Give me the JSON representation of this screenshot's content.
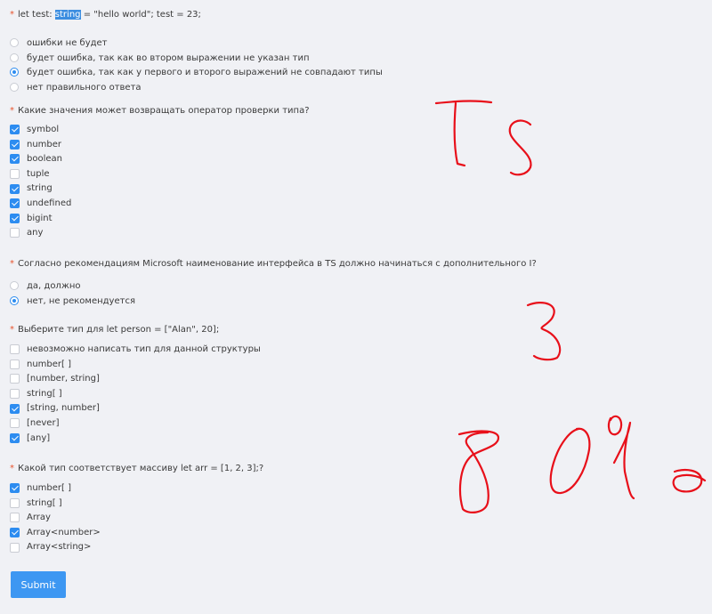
{
  "questions": [
    {
      "type": "radio",
      "prefix": "let test: ",
      "highlight": "string",
      "suffix": " = \"hello world\"; test = 23;",
      "options": [
        {
          "label": "ошибки не будет",
          "checked": false
        },
        {
          "label": "будет ошибка, так как во втором выражении не указан тип",
          "checked": false
        },
        {
          "label": "будет ошибка, так как у первого и второго выражений не совпадают типы",
          "checked": true
        },
        {
          "label": "нет правильного ответа",
          "checked": false
        }
      ]
    },
    {
      "type": "checkbox",
      "title": "Какие значения может возвращать оператор проверки типа?",
      "options": [
        {
          "label": "symbol",
          "checked": true
        },
        {
          "label": "number",
          "checked": true
        },
        {
          "label": "boolean",
          "checked": true
        },
        {
          "label": "tuple",
          "checked": false
        },
        {
          "label": "string",
          "checked": true
        },
        {
          "label": "undefined",
          "checked": true
        },
        {
          "label": "bigint",
          "checked": true
        },
        {
          "label": "any",
          "checked": false
        }
      ]
    },
    {
      "type": "radio",
      "title": "Согласно рекомендациям Microsoft наименование интерфейса в TS должно начинаться с дополнительного I?",
      "options": [
        {
          "label": "да, должно",
          "checked": false
        },
        {
          "label": "нет, не рекомендуется",
          "checked": true
        }
      ]
    },
    {
      "type": "checkbox",
      "title": "Выберите тип для let person = [\"Alan\", 20];",
      "options": [
        {
          "label": "невозможно написать тип для данной структуры",
          "checked": false
        },
        {
          "label": "number[ ]",
          "checked": false
        },
        {
          "label": "[number, string]",
          "checked": false
        },
        {
          "label": "string[ ]",
          "checked": false
        },
        {
          "label": "[string, number]",
          "checked": true
        },
        {
          "label": "[never]",
          "checked": false
        },
        {
          "label": "[any]",
          "checked": true
        }
      ]
    },
    {
      "type": "checkbox",
      "title": "Какой тип соответствует массиву let arr = [1, 2, 3];?",
      "options": [
        {
          "label": "number[ ]",
          "checked": true
        },
        {
          "label": "string[ ]",
          "checked": false
        },
        {
          "label": "Array",
          "checked": false
        },
        {
          "label": "Array<number>",
          "checked": true
        },
        {
          "label": "Array<string>",
          "checked": false
        }
      ]
    }
  ],
  "submit_label": "Submit",
  "colors": {
    "background": "#f0f1f5",
    "accent": "#2d8cf0",
    "required_star": "#e8552f",
    "handwriting": "#e8101a"
  },
  "required_marker": "*"
}
